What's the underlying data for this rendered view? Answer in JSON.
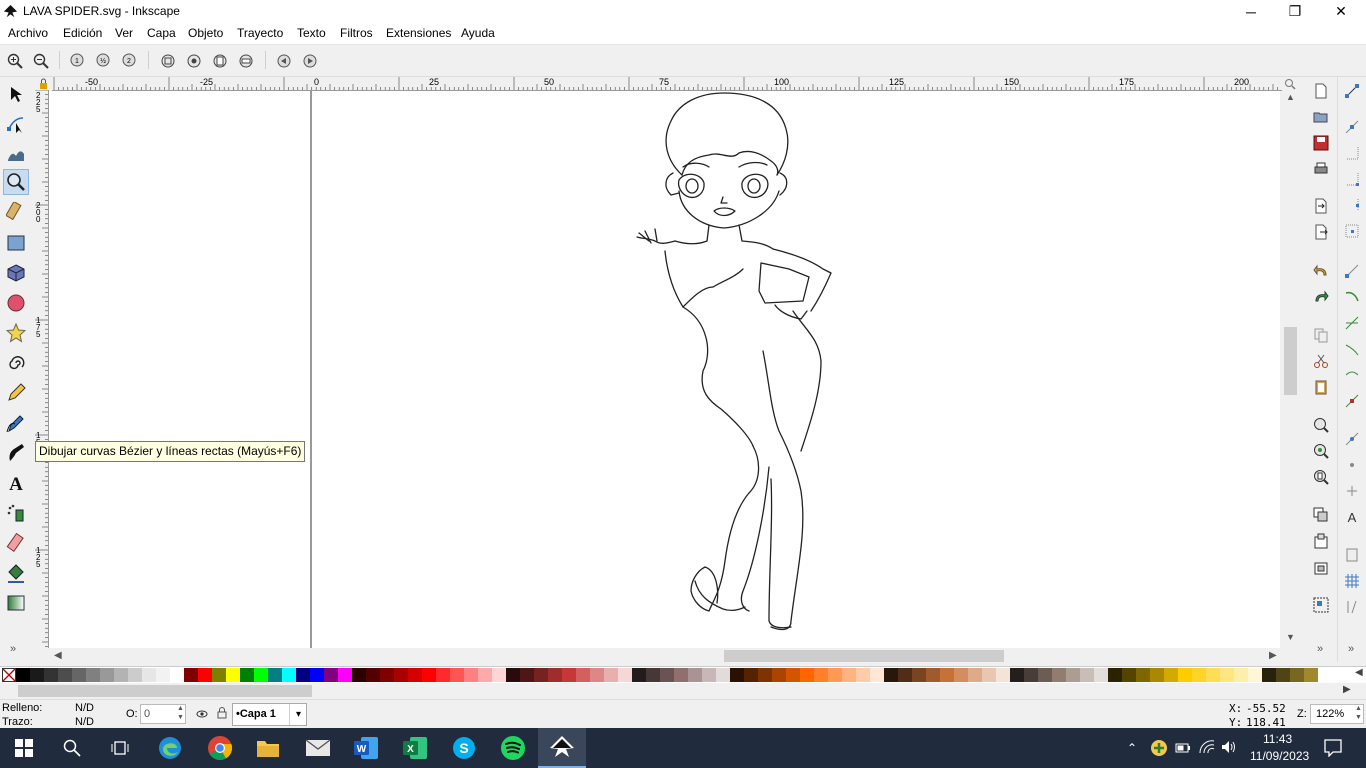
{
  "window": {
    "title": "LAVA SPIDER.svg - Inkscape",
    "minimize": "─",
    "maximize": "❐",
    "close": "✕"
  },
  "menu": {
    "items": [
      "Archivo",
      "Edición",
      "Ver",
      "Capa",
      "Objeto",
      "Trayecto",
      "Texto",
      "Filtros",
      "Extensiones",
      "Ayuda"
    ]
  },
  "toolbox": {
    "tooltip": "Dibujar curvas Bézier y líneas rectas (Mayús+F6)",
    "more": "»",
    "tools": [
      "selector-icon",
      "node-editor-icon",
      "tweak-icon",
      "zoom-icon",
      "measure-icon",
      "rectangle-icon",
      "3d-box-icon",
      "ellipse-icon",
      "star-icon",
      "spiral-icon",
      "pencil-icon",
      "bezier-pen-icon",
      "calligraphy-icon",
      "text-icon",
      "spray-icon",
      "eraser-icon",
      "paint-bucket-icon",
      "gradient-icon"
    ],
    "active": "zoom-icon"
  },
  "rulers": {
    "h_labels": [
      "-50",
      "-25",
      "0",
      "25",
      "50",
      "75",
      "100",
      "125",
      "150",
      "175",
      "200"
    ],
    "v_labels": [
      "2 2 5",
      "2 0 0",
      "1 7 5",
      "1 5 0",
      "1 2 5"
    ]
  },
  "colors": {
    "canvas": "#ffffff",
    "accent": "#8eb6e0",
    "taskbar": "#202b3d"
  },
  "palette": [
    "#000000",
    "#1a1a1a",
    "#333333",
    "#4d4d4d",
    "#666666",
    "#808080",
    "#999999",
    "#b3b3b3",
    "#cccccc",
    "#e6e6e6",
    "#f2f2f2",
    "#ffffff",
    "#800000",
    "#ff0000",
    "#808000",
    "#ffff00",
    "#008000",
    "#00ff00",
    "#008080",
    "#00ffff",
    "#000080",
    "#0000ff",
    "#800080",
    "#ff00ff",
    "#2b0000",
    "#550000",
    "#800000",
    "#aa0000",
    "#d40000",
    "#ff0000",
    "#ff2a2a",
    "#ff5555",
    "#ff8080",
    "#ffaaaa",
    "#ffd5d5",
    "#280b0b",
    "#501616",
    "#782121",
    "#a02c2c",
    "#c83737",
    "#d35f5f",
    "#de8787",
    "#e9afaf",
    "#f4d7d7",
    "#241c1c",
    "#483737",
    "#6c5353",
    "#916f6f",
    "#ac9393",
    "#c8b7b7",
    "#e3dbdb",
    "#2b1100",
    "#552200",
    "#803300",
    "#aa4400",
    "#d45500",
    "#ff6600",
    "#ff7f2a",
    "#ff9955",
    "#ffb380",
    "#ffccaa",
    "#ffe6d5",
    "#28170b",
    "#502d16",
    "#784421",
    "#a05a2c",
    "#c87137",
    "#d38d5f",
    "#deaa87",
    "#e9c6af",
    "#f4e3d7",
    "#241f1c",
    "#483e37",
    "#6c5d53",
    "#917c6f",
    "#ac9d93",
    "#c8beb7",
    "#e3dedb",
    "#2b2200",
    "#554400",
    "#806600",
    "#aa8800",
    "#d4aa00",
    "#ffcc00",
    "#ffd42a",
    "#ffdd55",
    "#ffe680",
    "#ffeeaa",
    "#fff6d5",
    "#28220b",
    "#504416",
    "#786721",
    "#a0892c"
  ],
  "status": {
    "fill_label": "Relleno:",
    "fill_value": "N/D",
    "stroke_label": "Trazo:",
    "stroke_value": "N/D",
    "opacity_label": "O:",
    "opacity_value": "0",
    "layer": "•Capa 1",
    "x_label": "X:",
    "x_value": "-55.52",
    "y_label": "Y:",
    "y_value": "118.41",
    "zoom_label": "Z:",
    "zoom_value": "122%"
  },
  "taskbar": {
    "apps": [
      "windows-start-icon",
      "search-icon",
      "task-view-icon",
      "edge-icon",
      "chrome-icon",
      "file-explorer-icon",
      "mail-icon",
      "word-icon",
      "excel-icon",
      "skype-icon",
      "spotify-icon",
      "inkscape-icon"
    ],
    "time": "11:43",
    "date": "11/09/2023"
  }
}
